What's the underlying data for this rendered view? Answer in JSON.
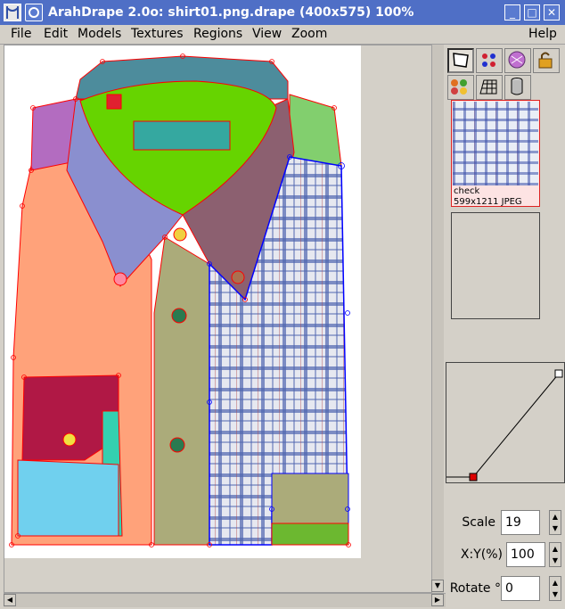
{
  "window": {
    "title": "ArahDrape 2.0o: shirt01.png.drape (400x575) 100%",
    "minimize_label": "_",
    "maximize_label": "□",
    "close_label": "✕"
  },
  "menu": [
    "File",
    "Edit",
    "Models",
    "Textures",
    "Regions",
    "View",
    "Zoom",
    "Help"
  ],
  "tools": [
    {
      "name": "region-tool",
      "icon": "polygon-select-icon"
    },
    {
      "name": "dots-tool",
      "icon": "color-dots-icon"
    },
    {
      "name": "pattern-tool",
      "icon": "pattern-ball-icon"
    },
    {
      "name": "lock-tool",
      "icon": "lock-icon"
    },
    {
      "name": "masks-tool",
      "icon": "masks-icon"
    },
    {
      "name": "grid-tool",
      "icon": "grid-icon"
    },
    {
      "name": "cylinder-tool",
      "icon": "cylinder-icon"
    }
  ],
  "texture": {
    "name": "check",
    "info": "599x1211 JPEG"
  },
  "controls": {
    "scale_label": "Scale",
    "scale_value": "19",
    "xy_label": "X:Y(%)",
    "xy_value": "100",
    "rotate_label": "Rotate °",
    "rotate_value": "0"
  },
  "colors": {
    "titlebar": "#4f6fc6",
    "region_outline": "#ff0000",
    "selected_outline": "#0000ff"
  }
}
